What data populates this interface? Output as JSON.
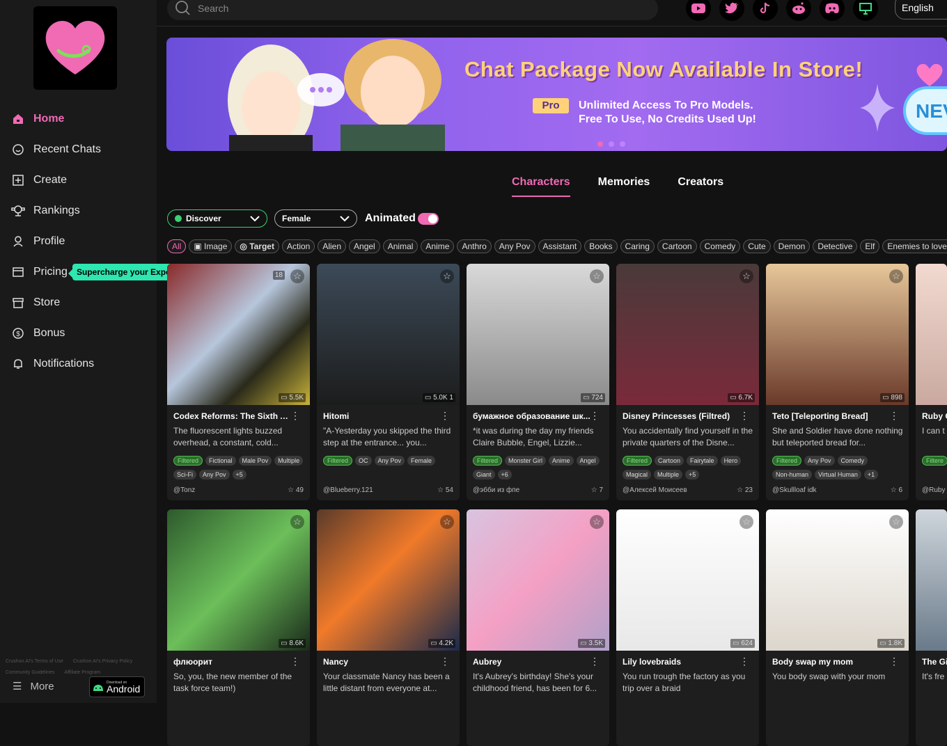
{
  "sidebar": {
    "nav": [
      {
        "label": "Home",
        "icon": "home-icon"
      },
      {
        "label": "Recent Chats",
        "icon": "chat-icon"
      },
      {
        "label": "Create",
        "icon": "plus-square-icon"
      },
      {
        "label": "Rankings",
        "icon": "trophy-icon"
      },
      {
        "label": "Profile",
        "icon": "user-icon"
      },
      {
        "label": "Pricing",
        "icon": "card-icon"
      },
      {
        "label": "Store",
        "icon": "store-icon"
      },
      {
        "label": "Bonus",
        "icon": "coin-icon"
      },
      {
        "label": "Notifications",
        "icon": "bell-icon"
      }
    ],
    "pricing_tip": "Supercharge your Experience",
    "footer": [
      "Crushon.AI's Terms of Use",
      "Crushon.AI's Privacy Policy",
      "Community Guidelines",
      "Affiliate Program"
    ],
    "more": "More",
    "android_small": "Download on",
    "android_big": "Android"
  },
  "topbar": {
    "search_placeholder": "Search",
    "language": "English",
    "socials": [
      "youtube-icon",
      "twitter-icon",
      "tiktok-icon",
      "reddit-icon",
      "discord-icon",
      "monitor-icon"
    ]
  },
  "banner": {
    "title": "Chat Package Now Available In Store!",
    "pro": "Pro",
    "line1": "Unlimited Access To Pro Models.",
    "line2": "Free To Use, No Credits Used Up!",
    "new": "NEV"
  },
  "tabs": [
    "Characters",
    "Memories",
    "Creators"
  ],
  "filters": {
    "discover": "Discover",
    "gender": "Female",
    "animated": "Animated"
  },
  "tags": [
    "All",
    "Image",
    "Target",
    "Action",
    "Alien",
    "Angel",
    "Animal",
    "Anime",
    "Anthro",
    "Any Pov",
    "Assistant",
    "Books",
    "Caring",
    "Cartoon",
    "Comedy",
    "Cute",
    "Demon",
    "Detective",
    "Elf",
    "Enemies to lovers"
  ],
  "cards": [
    {
      "title": "Codex Reforms: The Sixth Ar...",
      "desc": "The fluorescent lights buzzed overhead, a constant, cold...",
      "tags": [
        "Filtered",
        "Fictional",
        "Male Pov",
        "Multiple",
        "Sci-Fi",
        "Any Pov",
        "+5"
      ],
      "author": "@Tonz",
      "likes": "49",
      "count": "5.5K",
      "badge": "18"
    },
    {
      "title": "Hitomi",
      "desc": "\"A-Yesterday you skipped the third step at the entrance... you...",
      "tags": [
        "Filtered",
        "OC",
        "Any Pov",
        "Female"
      ],
      "author": "@Blueberry.121",
      "likes": "54",
      "count": "5.0K  1"
    },
    {
      "title": "бумажное образование шк...",
      "desc": "*it was during the day my friends Claire Bubble, Engel, Lizzie...",
      "tags": [
        "Filtered",
        "Monster Girl",
        "Anime",
        "Angel",
        "Giant",
        "+6"
      ],
      "author": "@эбби из фпе",
      "likes": "7",
      "count": "724"
    },
    {
      "title": "Disney Princesses (Filtred)",
      "desc": "You accidentally find yourself in the private quarters of the Disne...",
      "tags": [
        "Filtered",
        "Cartoon",
        "Fairytale",
        "Hero",
        "Magical",
        "Multiple",
        "+5"
      ],
      "author": "@Алексей Моисеев",
      "likes": "23",
      "count": "6.7K"
    },
    {
      "title": "Teto [Teleporting Bread]",
      "desc": "She and Soldier have done nothing but teleported bread for...",
      "tags": [
        "Filtered",
        "Any Pov",
        "Comedy",
        "Non-human",
        "Virtual Human",
        "+1"
      ],
      "author": "@Skullloaf idk",
      "likes": "6",
      "count": "898"
    },
    {
      "title": "Ruby C",
      "desc": "I can t want?",
      "tags": [
        "Filtere"
      ],
      "author": "@Ruby",
      "likes": "",
      "count": ""
    },
    {
      "title": "флюорит",
      "desc": "So, you, the new member of the task force team!)",
      "tags": [],
      "author": "",
      "likes": "",
      "count": "8.6K"
    },
    {
      "title": "Nancy",
      "desc": "Your classmate Nancy has been a little distant from everyone at...",
      "tags": [],
      "author": "",
      "likes": "",
      "count": "4.2K"
    },
    {
      "title": "Aubrey",
      "desc": "It's Aubrey's birthday! She's your childhood friend, has been for 6...",
      "tags": [],
      "author": "",
      "likes": "",
      "count": "3.5K"
    },
    {
      "title": "Lily lovebraids",
      "desc": "You run trough the factory as you trip over a braid",
      "tags": [],
      "author": "",
      "likes": "",
      "count": "624"
    },
    {
      "title": "Body swap my mom",
      "desc": "You body swap with your mom",
      "tags": [],
      "author": "",
      "likes": "",
      "count": "1.8K"
    },
    {
      "title": "The Gi",
      "desc": "It's fre stop. Y",
      "tags": [],
      "author": "",
      "likes": "",
      "count": ""
    }
  ]
}
